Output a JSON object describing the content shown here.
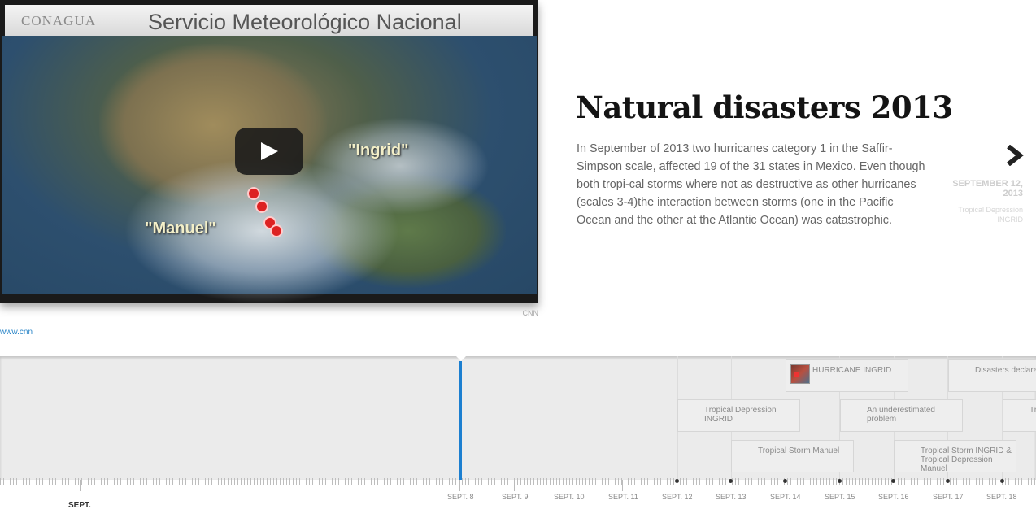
{
  "media": {
    "banner_logo": "CONAGUA",
    "banner_title": "Servicio Meteorológico Nacional",
    "label_ingrid": "\"Ingrid\"",
    "label_manuel": "\"Manuel\"",
    "credit": "CNN",
    "source_link": "www.cnn"
  },
  "article": {
    "title": "Natural disasters 2013",
    "description": "In September of 2013 two hurricanes category 1 in the Saffir-Simpson scale, affected 19 of the 31 states in Mexico. Even though both tropi-cal storms where not as destructive as other hurricanes (scales 3-4)the interaction between storms (one in the Pacific Ocean and the other at the Atlantic Ocean) was catastrophic."
  },
  "next": {
    "date": "SEPTEMBER 12, 2013",
    "title": "Tropical Depression INGRID"
  },
  "timeline": {
    "month_label": "SEPT.",
    "dates": [
      "SEPT. 8",
      "SEPT. 9",
      "SEPT. 10",
      "SEPT. 11",
      "SEPT. 12",
      "SEPT. 13",
      "SEPT. 14",
      "SEPT. 15",
      "SEPT. 16",
      "SEPT. 17",
      "SEPT. 18"
    ],
    "events": [
      {
        "label": "HURRICANE INGRID",
        "has_thumbnail": true
      },
      {
        "label": "Disasters declara"
      },
      {
        "label": "Tropical Depression INGRID"
      },
      {
        "label": "An underestimated problem"
      },
      {
        "label": "Tr"
      },
      {
        "label": "Tropical Storm Manuel"
      },
      {
        "label": "Tropical Storm INGRID & Tropical Depression Manuel"
      }
    ]
  },
  "colors": {
    "accent": "#1c7fd0",
    "link": "#2b86c8"
  },
  "icons": [
    "play-icon",
    "chevron-right-icon"
  ]
}
